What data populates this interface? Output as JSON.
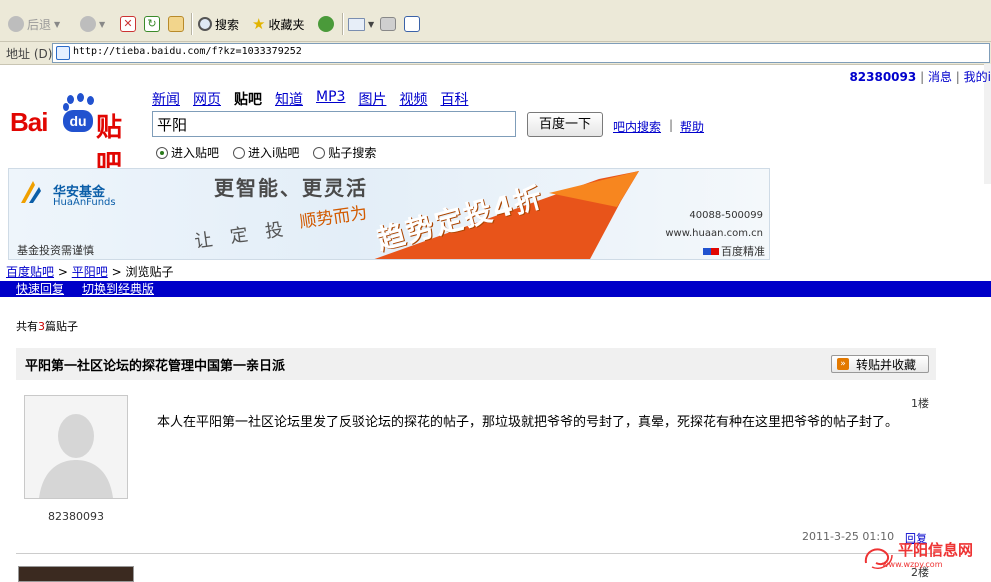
{
  "browser": {
    "toolbar": {
      "back_label": "后退",
      "search_label": "搜索",
      "favorites_label": "收藏夹"
    },
    "address": {
      "label": "地址 (D)",
      "url": "http://tieba.baidu.com/f?kz=1033379252"
    }
  },
  "userbar": {
    "username": "82380093",
    "messages": "消息",
    "my": "我的i",
    "sep": "|"
  },
  "header": {
    "logo_bai": "Bai",
    "logo_du": "du",
    "logo_tieba": "贴吧",
    "tabs": [
      {
        "label": "新闻",
        "active": false
      },
      {
        "label": "网页",
        "active": false
      },
      {
        "label": "贴吧",
        "active": true
      },
      {
        "label": "知道",
        "active": false
      },
      {
        "label": "MP3",
        "active": false
      },
      {
        "label": "图片",
        "active": false
      },
      {
        "label": "视频",
        "active": false
      },
      {
        "label": "百科",
        "active": false
      }
    ],
    "search_value": "平阳",
    "search_button": "百度一下",
    "inbar_search": "吧内搜索",
    "help": "帮助",
    "help_sep": "|",
    "radios": [
      {
        "label": "进入贴吧",
        "checked": true
      },
      {
        "label": "进入i贴吧",
        "checked": false
      },
      {
        "label": "贴子搜索",
        "checked": false
      }
    ]
  },
  "banner": {
    "brand_cn": "华安基金",
    "brand_en": "HuaAnFunds",
    "headline": "更智能、更灵活",
    "sub_left": "让 定 投",
    "sub_right": "顺势而为",
    "trend": "趋势定投4折",
    "phone": "40088-500099",
    "url": "www.huaan.com.cn",
    "risk": "基金投资需谨慎",
    "baidu_tag": "百度精准"
  },
  "breadcrumb": {
    "items": [
      "百度贴吧",
      "平阳吧",
      "浏览贴子"
    ],
    "sep": ">"
  },
  "bluebar": {
    "quick_reply": "快速回复",
    "classic": "切换到经典版"
  },
  "post_count": {
    "prefix": "共有",
    "count": "3",
    "suffix": "篇贴子"
  },
  "thread": {
    "title": "平阳第一社区论坛的探花管理中国第一亲日派",
    "fav_button": "转贴并收藏",
    "posts": [
      {
        "floor": "1楼",
        "author": "82380093",
        "body": "本人在平阳第一社区论坛里发了反驳论坛的探花的帖子，那垃圾就把爷爷的号封了，真晕，死探花有种在这里把爷爷的帖子封了。",
        "time": "2011-3-25 01:10",
        "reply": "回复"
      },
      {
        "floor": "2楼"
      }
    ]
  },
  "watermark": {
    "cn": "平阳信息网",
    "url": "www.wzpy.com"
  },
  "colors": {
    "accent_blue": "#0000c8",
    "baidu_red": "#e10602",
    "baidu_blue": "#2152cf",
    "link": "#0000cc"
  }
}
